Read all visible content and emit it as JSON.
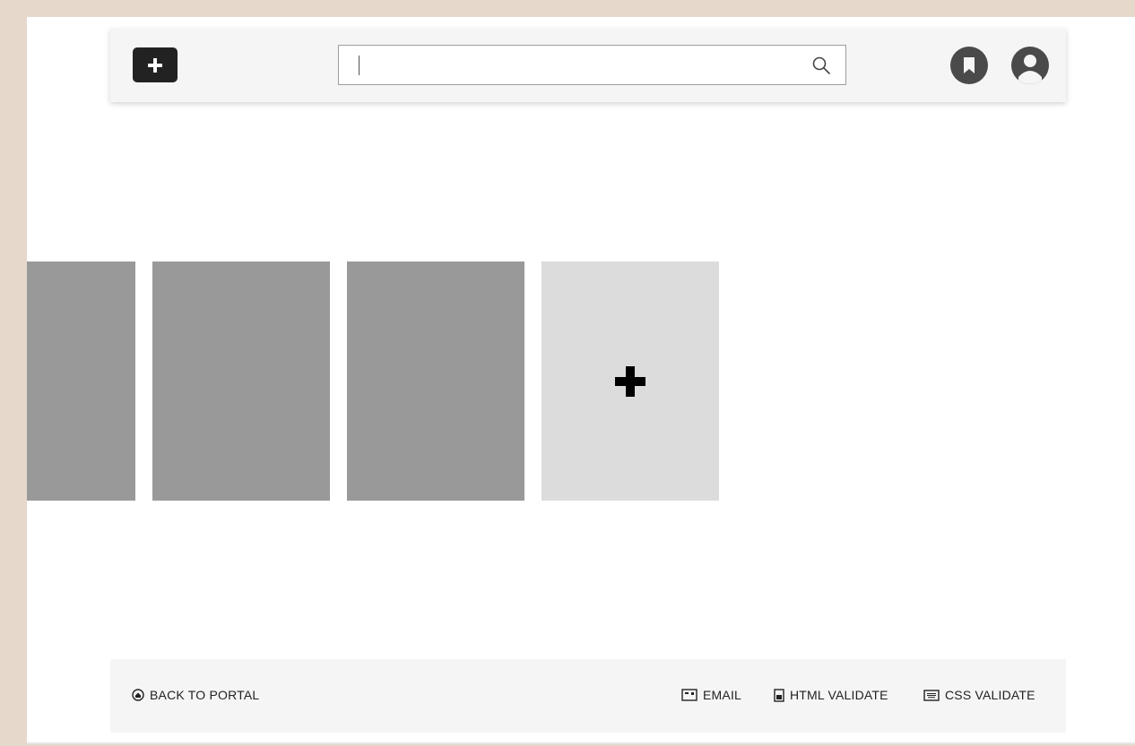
{
  "header": {
    "add_button_icon": "plus-icon",
    "search": {
      "value": "",
      "placeholder": "",
      "icon": "search-icon"
    },
    "bookmark_icon": "bookmark-icon",
    "user_icon": "user-icon"
  },
  "gallery": {
    "cards": [
      {
        "kind": "placeholder",
        "color": "#999999"
      },
      {
        "kind": "placeholder",
        "color": "#999999"
      },
      {
        "kind": "placeholder",
        "color": "#999999"
      },
      {
        "kind": "add",
        "color": "#dcdcdc",
        "icon": "plus-icon"
      }
    ]
  },
  "footer": {
    "back_label": "BACK TO PORTAL",
    "email_label": "EMAIL",
    "html_validate_label": "HTML VALIDATE",
    "css_validate_label": "CSS VALIDATE"
  },
  "colors": {
    "frame": "#e6d9cc",
    "bar": "#f5f5f5",
    "dark": "#222222",
    "card": "#999999",
    "add_card": "#dcdcdc"
  }
}
